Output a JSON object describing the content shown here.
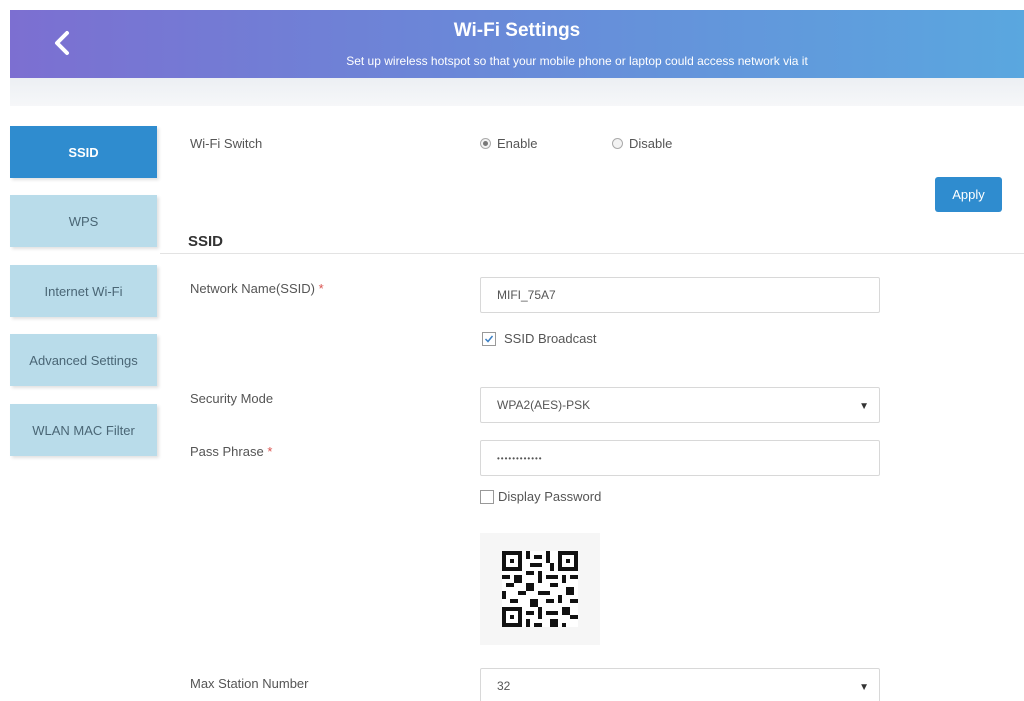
{
  "header": {
    "back_icon": "chevron-left-icon",
    "title": "Wi-Fi Settings",
    "subtitle": "Set up wireless hotspot so that your mobile phone or laptop could access network via it"
  },
  "sidebar": {
    "items": [
      {
        "label": "SSID",
        "active": true
      },
      {
        "label": "WPS",
        "active": false
      },
      {
        "label": "Internet Wi-Fi",
        "active": false
      },
      {
        "label": "Advanced Settings",
        "active": false
      },
      {
        "label": "WLAN MAC Filter",
        "active": false
      }
    ]
  },
  "wifi_switch": {
    "label": "Wi-Fi Switch",
    "options": [
      {
        "label": "Enable",
        "selected": true
      },
      {
        "label": "Disable",
        "selected": false
      }
    ]
  },
  "apply_label": "Apply",
  "section_title": "SSID",
  "network_name": {
    "label": "Network Name(SSID)",
    "required_mark": "*",
    "value": "MIFI_75A7"
  },
  "ssid_broadcast": {
    "label": "SSID Broadcast",
    "checked": true
  },
  "security_mode": {
    "label": "Security Mode",
    "value": "WPA2(AES)-PSK"
  },
  "pass_phrase": {
    "label": "Pass Phrase",
    "required_mark": "*",
    "masked_value": "••••••••••••"
  },
  "display_password": {
    "label": "Display Password",
    "checked": false
  },
  "qr_code_icon": "qr-code",
  "max_station": {
    "label": "Max Station Number",
    "value": "32"
  },
  "colors": {
    "header_gradient_start": "#7c6fd1",
    "header_gradient_end": "#5aa7df",
    "accent_blue": "#2f8ccf",
    "tab_inactive": "#b9dcea",
    "required": "#d9534f"
  }
}
